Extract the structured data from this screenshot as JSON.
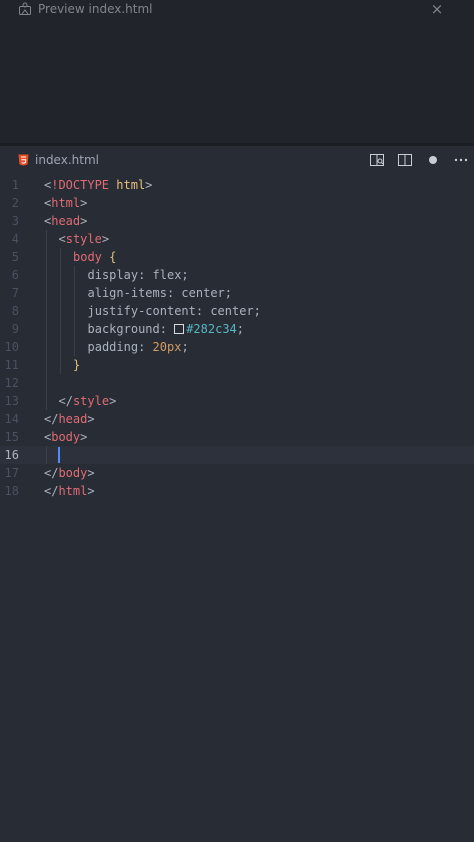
{
  "preview": {
    "tab_label": "Preview index.html",
    "close_icon": "×"
  },
  "editor": {
    "tab_label": "index.html",
    "file_icon": "html5-icon",
    "actions": [
      "open-preview-icon",
      "split-editor-icon",
      "unsaved-dot-icon",
      "more-actions-icon"
    ]
  },
  "colors": {
    "background": "#282c34",
    "tag": "#e06c75",
    "keyword": "#e5c07b",
    "number": "#d19a66",
    "hex": "#56b6c2",
    "plain": "#abb2bf",
    "line_number": "#495162",
    "cursor": "#528bff"
  },
  "code": {
    "current_line": 16,
    "lines": [
      {
        "n": "1",
        "tokens": [
          {
            "t": "<",
            "c": "p"
          },
          {
            "t": "!DOCTYPE",
            "c": "t"
          },
          {
            "t": " ",
            "c": "p"
          },
          {
            "t": "html",
            "c": "k"
          },
          {
            "t": ">",
            "c": "p"
          }
        ]
      },
      {
        "n": "2",
        "tokens": [
          {
            "t": "<",
            "c": "p"
          },
          {
            "t": "html",
            "c": "t"
          },
          {
            "t": ">",
            "c": "p"
          }
        ]
      },
      {
        "n": "3",
        "tokens": [
          {
            "t": "<",
            "c": "p"
          },
          {
            "t": "head",
            "c": "t"
          },
          {
            "t": ">",
            "c": "p"
          }
        ]
      },
      {
        "n": "4",
        "indent": 1,
        "tokens": [
          {
            "t": "<",
            "c": "p"
          },
          {
            "t": "style",
            "c": "t"
          },
          {
            "t": ">",
            "c": "p"
          }
        ]
      },
      {
        "n": "5",
        "indent": 2,
        "tokens": [
          {
            "t": "body",
            "c": "t"
          },
          {
            "t": " ",
            "c": "p"
          },
          {
            "t": "{",
            "c": "b"
          }
        ]
      },
      {
        "n": "6",
        "indent": 3,
        "tokens": [
          {
            "t": "display: flex;",
            "c": "p"
          }
        ]
      },
      {
        "n": "7",
        "indent": 3,
        "tokens": [
          {
            "t": "align-items: center;",
            "c": "p"
          }
        ]
      },
      {
        "n": "8",
        "indent": 3,
        "tokens": [
          {
            "t": "justify-content: center;",
            "c": "p"
          }
        ]
      },
      {
        "n": "9",
        "indent": 3,
        "tokens": [
          {
            "t": "background: ",
            "c": "p"
          },
          {
            "swatch": true
          },
          {
            "t": "#282c34",
            "c": "hex"
          },
          {
            "t": ";",
            "c": "p"
          }
        ]
      },
      {
        "n": "10",
        "indent": 3,
        "tokens": [
          {
            "t": "padding: ",
            "c": "p"
          },
          {
            "t": "20px",
            "c": "n"
          },
          {
            "t": ";",
            "c": "p"
          }
        ]
      },
      {
        "n": "11",
        "indent": 2,
        "tokens": [
          {
            "t": "}",
            "c": "b"
          }
        ]
      },
      {
        "n": "12",
        "indent": 1,
        "tokens": []
      },
      {
        "n": "13",
        "indent": 1,
        "tokens": [
          {
            "t": "</",
            "c": "p"
          },
          {
            "t": "style",
            "c": "t"
          },
          {
            "t": ">",
            "c": "p"
          }
        ]
      },
      {
        "n": "14",
        "tokens": [
          {
            "t": "</",
            "c": "p"
          },
          {
            "t": "head",
            "c": "t"
          },
          {
            "t": ">",
            "c": "p"
          }
        ]
      },
      {
        "n": "15",
        "tokens": [
          {
            "t": "<",
            "c": "p"
          },
          {
            "t": "body",
            "c": "t"
          },
          {
            "t": ">",
            "c": "p"
          }
        ]
      },
      {
        "n": "16",
        "indent": 1,
        "tokens": []
      },
      {
        "n": "17",
        "tokens": [
          {
            "t": "</",
            "c": "p"
          },
          {
            "t": "body",
            "c": "t"
          },
          {
            "t": ">",
            "c": "p"
          }
        ]
      },
      {
        "n": "18",
        "tokens": [
          {
            "t": "</",
            "c": "p"
          },
          {
            "t": "html",
            "c": "t"
          },
          {
            "t": ">",
            "c": "p"
          }
        ]
      }
    ]
  }
}
